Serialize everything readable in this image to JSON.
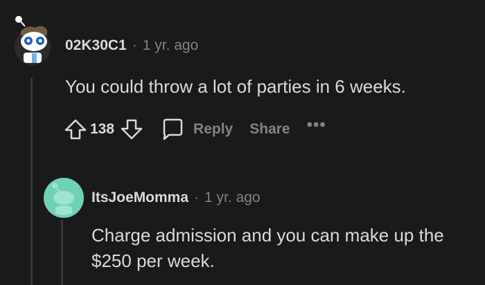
{
  "comment_1": {
    "author": "02K30C1",
    "separator": "·",
    "time": "1 yr. ago",
    "text": "You could throw a lot of parties in 6 weeks.",
    "vote_count": "138",
    "reply_label": "Reply",
    "share_label": "Share",
    "more_label": "•••"
  },
  "comment_2": {
    "author": "ItsJoeMomma",
    "separator": "·",
    "time": "1 yr. ago",
    "text": "Charge admission and you can make up the $250 per week."
  },
  "icons": {
    "avatar_1": "reddit-snoo-avatar",
    "avatar_2": "reddit-default-avatar",
    "upvote": "upvote-arrow-icon",
    "downvote": "downvote-arrow-icon",
    "reply": "reply-bubble-icon",
    "more": "ellipsis-icon"
  },
  "colors": {
    "background": "#1a1a1b",
    "text_primary": "#d7dadc",
    "text_secondary": "#818384",
    "thread_line": "#343536",
    "avatar_teal": "#6fd1b6"
  }
}
